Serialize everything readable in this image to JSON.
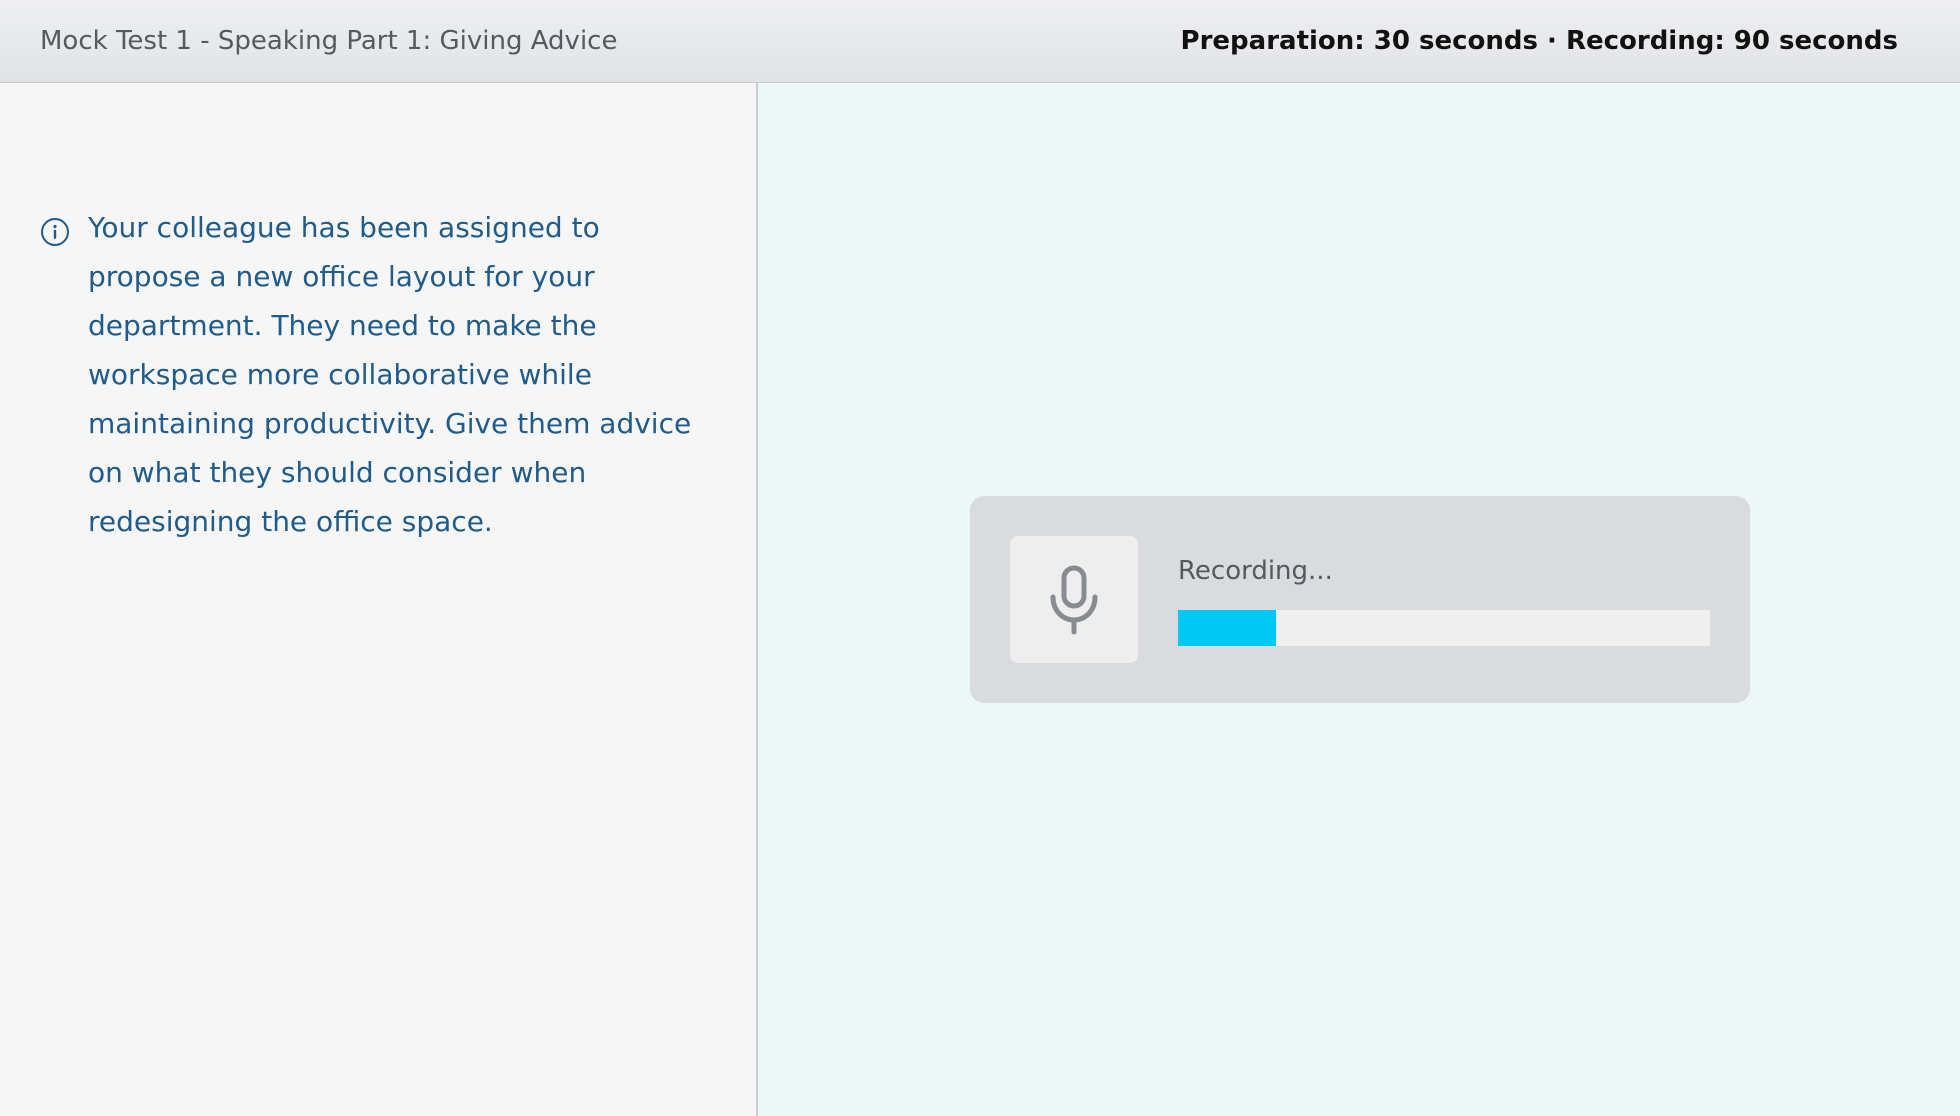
{
  "header": {
    "title": "Mock Test 1 - Speaking Part 1: Giving Advice",
    "timing": "Preparation: 30 seconds · Recording: 90 seconds"
  },
  "instructions": {
    "icon": "info-icon",
    "text": "Your colleague has been assigned to propose a new office layout for your department. They need to make the workspace more collaborative while maintaining productivity. Give them advice on what they should consider when redesigning the office space."
  },
  "recorder": {
    "icon": "microphone-icon",
    "status_label": "Recording...",
    "progress_fraction": 0.185,
    "progress_color": "#00c8f5"
  },
  "colors": {
    "instruction_text": "#1f5b8b",
    "right_pane_bg": "#eef7f7",
    "card_bg": "#d9dbdf"
  }
}
